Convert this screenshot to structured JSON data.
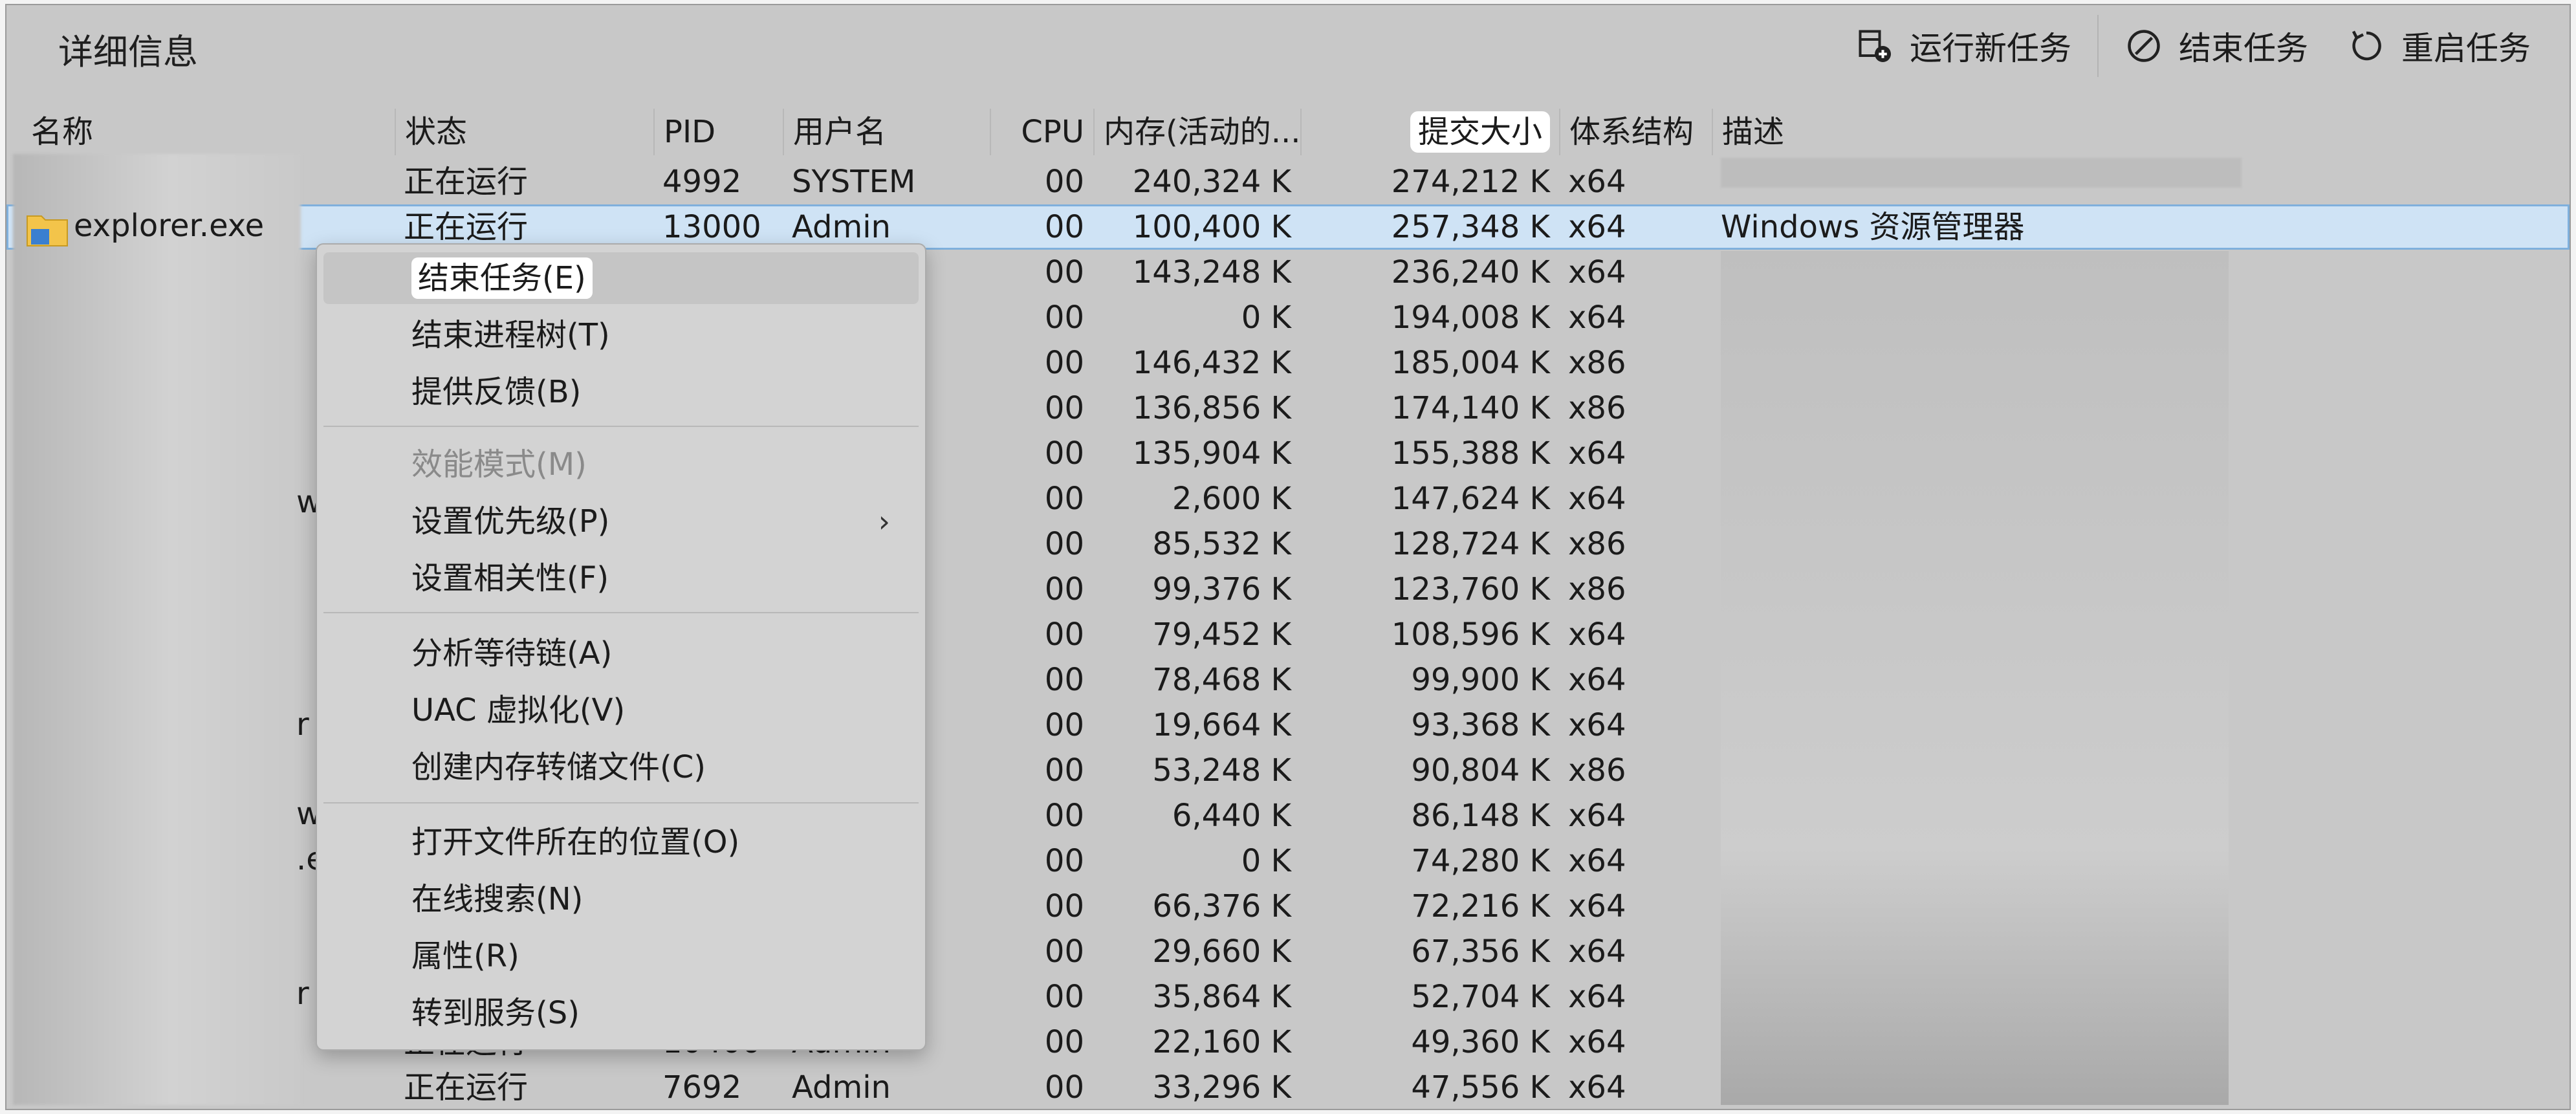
{
  "window": {
    "title": "详细信息"
  },
  "toolbar": {
    "run_new_task": "运行新任务",
    "end_task": "结束任务",
    "restart_task": "重启任务"
  },
  "columns": {
    "name": "名称",
    "status": "状态",
    "pid": "PID",
    "user": "用户名",
    "cpu": "CPU",
    "memory": "内存(活动的...",
    "commit": "提交大小",
    "arch": "体系结构",
    "desc": "描述"
  },
  "rows": [
    {
      "status": "正在运行",
      "pid": "4992",
      "user": "SYSTEM",
      "cpu": "00",
      "memory": "240,324 K",
      "commit": "274,212 K",
      "arch": "x64"
    },
    {
      "name": "explorer.exe",
      "status": "正在运行",
      "pid": "13000",
      "user": "Admin",
      "cpu": "00",
      "memory": "100,400 K",
      "commit": "257,348 K",
      "arch": "x64",
      "desc": "Windows 资源管理器"
    },
    {
      "cpu": "00",
      "memory": "143,248 K",
      "commit": "236,240 K",
      "arch": "x64"
    },
    {
      "cpu": "00",
      "memory": "0 K",
      "commit": "194,008 K",
      "arch": "x64"
    },
    {
      "cpu": "00",
      "memory": "146,432 K",
      "commit": "185,004 K",
      "arch": "x86"
    },
    {
      "cpu": "00",
      "memory": "136,856 K",
      "commit": "174,140 K",
      "arch": "x86"
    },
    {
      "cpu": "00",
      "memory": "135,904 K",
      "commit": "155,388 K",
      "arch": "x64"
    },
    {
      "cpu": "00",
      "memory": "2,600 K",
      "commit": "147,624 K",
      "arch": "x64"
    },
    {
      "cpu": "00",
      "memory": "85,532 K",
      "commit": "128,724 K",
      "arch": "x86"
    },
    {
      "cpu": "00",
      "memory": "99,376 K",
      "commit": "123,760 K",
      "arch": "x86"
    },
    {
      "cpu": "00",
      "memory": "79,452 K",
      "commit": "108,596 K",
      "arch": "x64"
    },
    {
      "cpu": "00",
      "memory": "78,468 K",
      "commit": "99,900 K",
      "arch": "x64"
    },
    {
      "cpu": "00",
      "memory": "19,664 K",
      "commit": "93,368 K",
      "arch": "x64"
    },
    {
      "cpu": "00",
      "memory": "53,248 K",
      "commit": "90,804 K",
      "arch": "x86"
    },
    {
      "cpu": "00",
      "memory": "6,440 K",
      "commit": "86,148 K",
      "arch": "x64"
    },
    {
      "cpu": "00",
      "memory": "0 K",
      "commit": "74,280 K",
      "arch": "x64"
    },
    {
      "cpu": "00",
      "memory": "66,376 K",
      "commit": "72,216 K",
      "arch": "x64"
    },
    {
      "cpu": "00",
      "memory": "29,660 K",
      "commit": "67,356 K",
      "arch": "x64"
    },
    {
      "cpu": "00",
      "memory": "35,864 K",
      "commit": "52,704 K",
      "arch": "x64"
    },
    {
      "status": "正在运行",
      "pid": "10400",
      "user": "Admin",
      "cpu": "00",
      "memory": "22,160 K",
      "commit": "49,360 K",
      "arch": "x64"
    },
    {
      "status": "正在运行",
      "pid": "7692",
      "user": "Admin",
      "cpu": "00",
      "memory": "33,296 K",
      "commit": "47,556 K",
      "arch": "x64"
    }
  ],
  "partial_chars": [
    "w",
    "r",
    "w",
    ".e",
    "r"
  ],
  "context_menu": {
    "end_task": "结束任务(E)",
    "end_tree": "结束进程树(T)",
    "feedback": "提供反馈(B)",
    "efficiency": "效能模式(M)",
    "priority": "设置优先级(P)",
    "affinity": "设置相关性(F)",
    "wait_chain": "分析等待链(A)",
    "uac": "UAC 虚拟化(V)",
    "dump": "创建内存转储文件(C)",
    "open_location": "打开文件所在的位置(O)",
    "search_online": "在线搜索(N)",
    "properties": "属性(R)",
    "go_services": "转到服务(S)",
    "chevron": "›"
  },
  "colors": {
    "selected_row": "#cfe3f5",
    "window_bg": "#c8c8c8"
  }
}
